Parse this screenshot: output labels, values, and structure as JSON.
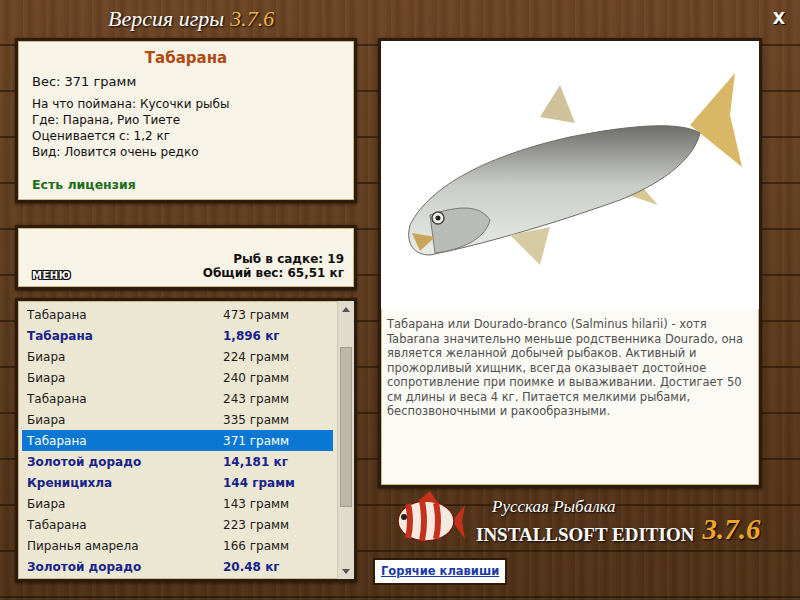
{
  "window": {
    "title": "Версия игры",
    "version": "3.7.6",
    "close": "X"
  },
  "fish": {
    "name": "Табарана",
    "details": [
      "Вес: 371 грамм",
      "На что поймана: Кусочки рыбы",
      "Где: Парана, Рио Тиете",
      "Оценивается с: 1,2 кг",
      "Вид: Ловится очень редко"
    ],
    "license": "Есть лицензия"
  },
  "summary": {
    "menu": "МЕНЮ",
    "count": "Рыб в садке: 19",
    "weight": "Общий вес: 65,51 кг"
  },
  "catch_list": {
    "rows": [
      {
        "name": "Табарана",
        "weight": "473 грамм",
        "highlighted": false,
        "selected": false
      },
      {
        "name": "Табарана",
        "weight": "1,896 кг",
        "highlighted": true,
        "selected": false
      },
      {
        "name": "Биара",
        "weight": "224 грамм",
        "highlighted": false,
        "selected": false
      },
      {
        "name": "Биара",
        "weight": "240 грамм",
        "highlighted": false,
        "selected": false
      },
      {
        "name": "Табарана",
        "weight": "243 грамм",
        "highlighted": false,
        "selected": false
      },
      {
        "name": "Биара",
        "weight": "335 грамм",
        "highlighted": false,
        "selected": false
      },
      {
        "name": "Табарана",
        "weight": "371 грамм",
        "highlighted": false,
        "selected": true
      },
      {
        "name": "Золотой дорадо",
        "weight": "14,181 кг",
        "highlighted": true,
        "selected": false
      },
      {
        "name": "Креницихла",
        "weight": "144 грамм",
        "highlighted": true,
        "selected": false
      },
      {
        "name": "Биара",
        "weight": "143 грамм",
        "highlighted": false,
        "selected": false
      },
      {
        "name": "Табарана",
        "weight": "223 грамм",
        "highlighted": false,
        "selected": false
      },
      {
        "name": "Пиранья амарела",
        "weight": "166 грамм",
        "highlighted": false,
        "selected": false
      },
      {
        "name": "Золотой дорадо",
        "weight": "20.48 кг",
        "highlighted": true,
        "selected": false
      }
    ],
    "scrollbar": {
      "offset": 0.12
    }
  },
  "description": "Табарана или Dourado-branco (Salminus hilarii) - хотя Tabarana значительно меньше родственника Dourado, она является желанной добычей рыбаков. Активный и прожорливый хищник, всегда оказывает достойное сопротивление при поимке и вываживании. Достигает 50 см длины и веса 4 кг. Питается мелкими рыбами, беспозвоночными и ракообразными.",
  "brand": {
    "title": "Русская Рыбалка",
    "edition": "INSTALLSOFT EDITION",
    "version": "3.7.6"
  },
  "hotkeys": "Горячие клавиши"
}
